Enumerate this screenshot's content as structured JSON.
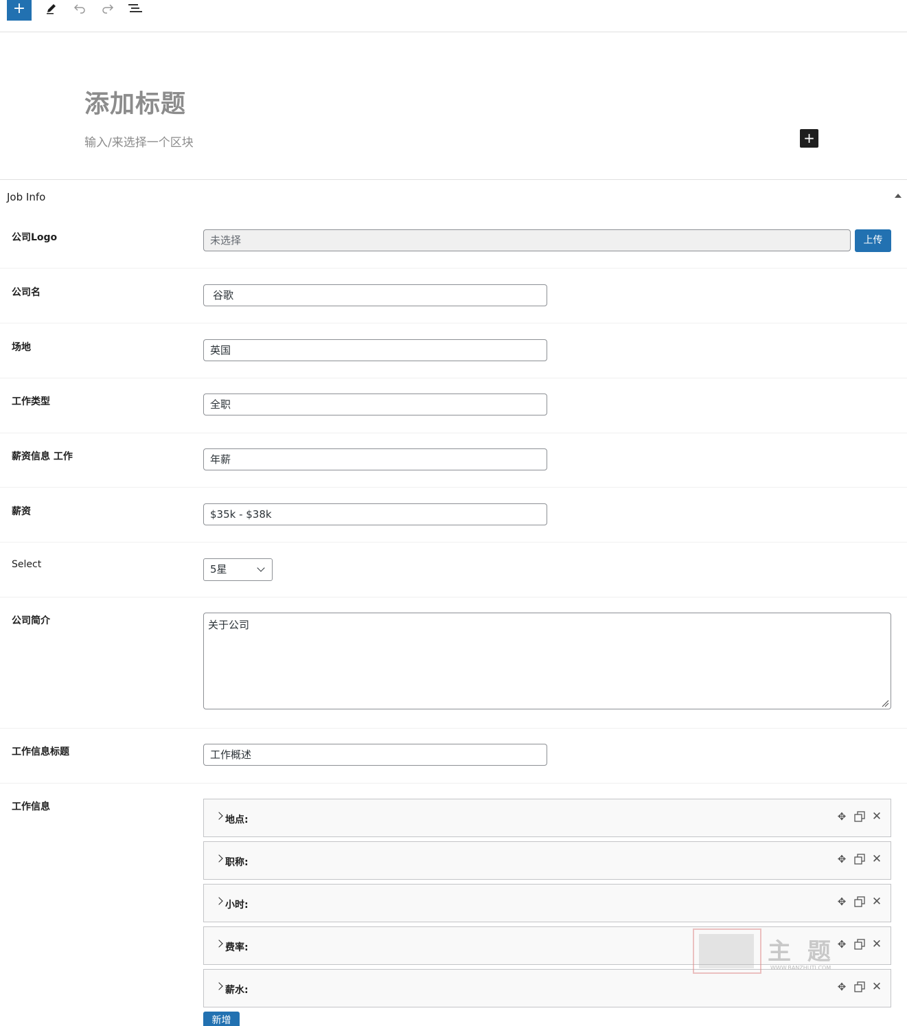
{
  "toolbar": {
    "add_label": "+",
    "edit_icon": "pencil-icon",
    "undo_icon": "undo-icon",
    "redo_icon": "redo-icon",
    "outline_icon": "list-view-icon"
  },
  "editor": {
    "title_placeholder": "添加标题",
    "block_hint": "输入/来选择一个区块",
    "block_add_label": "+"
  },
  "metabox": {
    "title": "Job Info",
    "fields": {
      "logo": {
        "label": "公司Logo",
        "value": "未选择",
        "button": "上传"
      },
      "company_name": {
        "label": "公司名",
        "value": "谷歌"
      },
      "location": {
        "label": "场地",
        "value": "英国"
      },
      "job_type": {
        "label": "工作类型",
        "value": "全职"
      },
      "salary_info": {
        "label": "薪资信息 工作",
        "value": "年薪"
      },
      "salary": {
        "label": "薪资",
        "value": "$35k - $38k"
      },
      "select": {
        "label": "Select",
        "value": "5星"
      },
      "company_intro": {
        "label": "公司简介",
        "value": "关于公司"
      },
      "job_info_title": {
        "label": "工作信息标题",
        "value": "工作概述"
      },
      "job_info": {
        "label": "工作信息",
        "groups": [
          "地点:",
          "职称:",
          "小时:",
          "费率:",
          "薪水:"
        ],
        "add_button": "新增"
      }
    }
  },
  "watermark": {
    "text": "主 题",
    "url": "WWW.BANZHUTI.COM"
  },
  "colors": {
    "primary": "#2271b1",
    "dark": "#1e1e1e",
    "muted": "#8c8c8c"
  }
}
